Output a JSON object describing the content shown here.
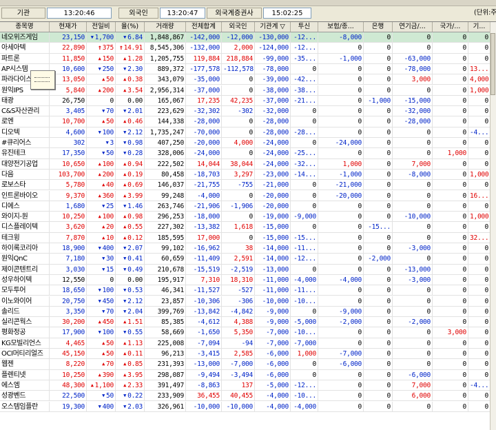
{
  "info_bar": {
    "inst_label": "기관",
    "inst_time": "13:20:46",
    "foreign_label": "외국인",
    "foreign_time": "13:20:47",
    "broker_label": "외국계증권사",
    "broker_time": "15:02:25",
    "unit_label": "(단위:주"
  },
  "headers": [
    "종목명",
    "현재가",
    "전일비",
    "율(%)",
    "거래량",
    "전체합계",
    "외국인",
    "기관계 ▽",
    "투신",
    "보험/종...",
    "은행",
    "연기금/...",
    "국가/...",
    "기..."
  ],
  "rows": [
    {
      "name": "네오위즈게임",
      "price": "23,150",
      "chg_dir": "dn",
      "chg": "1,700",
      "rate": "6.84",
      "vol": "1,848,867",
      "total": "-142,000",
      "foreign": "-12,000",
      "inst": "-130,000",
      "trust": "-12...",
      "ins": "-8,000",
      "bank": "0",
      "pension": "0",
      "nation": "0",
      "etc": "0"
    },
    {
      "name": "아세아텍",
      "price": "22,890",
      "chg_dir": "lim",
      "chg": "375",
      "rate": "14.91",
      "vol": "8,545,306",
      "total": "-132,000",
      "foreign": "2,000",
      "inst": "-124,000",
      "trust": "-12...",
      "ins": "0",
      "bank": "0",
      "pension": "0",
      "nation": "0",
      "etc": "0"
    },
    {
      "name": "파트론",
      "price": "11,850",
      "chg_dir": "up",
      "chg": "150",
      "rate": "1.28",
      "vol": "1,205,755",
      "total": "119,884",
      "foreign": "218,884",
      "inst": "-99,000",
      "trust": "-35...",
      "ins": "-1,000",
      "bank": "0",
      "pension": "-63,000",
      "nation": "0",
      "etc": "0"
    },
    {
      "name": "AP시스템",
      "price": "10,600",
      "chg_dir": "dn",
      "chg": "250",
      "rate": "2.30",
      "vol": "889,372",
      "total": "-177,578",
      "foreign": "-112,578",
      "inst": "-78,000",
      "trust": "0",
      "ins": "0",
      "bank": "0",
      "pension": "-78,000",
      "nation": "0",
      "etc": "13..."
    },
    {
      "name": "파라다이스",
      "price": "13,050",
      "chg_dir": "up",
      "chg": "50",
      "rate": "0.38",
      "vol": "343,079",
      "total": "-35,000",
      "foreign": "0",
      "inst": "-39,000",
      "trust": "-42...",
      "ins": "0",
      "bank": "0",
      "pension": "3,000",
      "nation": "0",
      "etc": "4,000"
    },
    {
      "name": "원익IPS",
      "price": "5,840",
      "chg_dir": "up",
      "chg": "200",
      "rate": "3.54",
      "vol": "2,956,314",
      "total": "-37,000",
      "foreign": "0",
      "inst": "-38,000",
      "trust": "-38...",
      "ins": "0",
      "bank": "0",
      "pension": "0",
      "nation": "0",
      "etc": "1,000"
    },
    {
      "name": "태광",
      "price": "26,750",
      "chg_dir": "none",
      "chg": "0",
      "rate": "0.00",
      "vol": "165,067",
      "total": "17,235",
      "foreign": "42,235",
      "inst": "-37,000",
      "trust": "-21...",
      "ins": "0",
      "bank": "-1,000",
      "pension": "-15,000",
      "nation": "0",
      "etc": "0"
    },
    {
      "name": "C&S자산관리",
      "price": "3,405",
      "chg_dir": "dn",
      "chg": "70",
      "rate": "2.01",
      "vol": "223,629",
      "total": "-32,302",
      "foreign": "-302",
      "inst": "-32,000",
      "trust": "0",
      "ins": "0",
      "bank": "0",
      "pension": "-32,000",
      "nation": "0",
      "etc": "0"
    },
    {
      "name": "로엔",
      "price": "10,700",
      "chg_dir": "up",
      "chg": "50",
      "rate": "0.46",
      "vol": "144,338",
      "total": "-28,000",
      "foreign": "0",
      "inst": "-28,000",
      "trust": "0",
      "ins": "0",
      "bank": "0",
      "pension": "-28,000",
      "nation": "0",
      "etc": "0"
    },
    {
      "name": "디오텍",
      "price": "4,600",
      "chg_dir": "dn",
      "chg": "100",
      "rate": "2.12",
      "vol": "1,735,247",
      "total": "-70,000",
      "foreign": "0",
      "inst": "-28,000",
      "trust": "-28...",
      "ins": "0",
      "bank": "0",
      "pension": "0",
      "nation": "0",
      "etc": "-4..."
    },
    {
      "name": "#큐리어스",
      "price": "302",
      "chg_dir": "dn",
      "chg": "3",
      "rate": "0.98",
      "vol": "407,250",
      "total": "-20,000",
      "foreign": "4,000",
      "inst": "-24,000",
      "trust": "0",
      "ins": "-24,000",
      "bank": "0",
      "pension": "0",
      "nation": "0",
      "etc": "0"
    },
    {
      "name": "유진테크",
      "price": "17,350",
      "chg_dir": "dn",
      "chg": "50",
      "rate": "0.28",
      "vol": "328,006",
      "total": "-24,000",
      "foreign": "0",
      "inst": "-24,000",
      "trust": "-25...",
      "ins": "0",
      "bank": "0",
      "pension": "0",
      "nation": "1,000",
      "etc": "0"
    },
    {
      "name": "대양전기공업",
      "price": "10,650",
      "chg_dir": "up",
      "chg": "100",
      "rate": "0.94",
      "vol": "222,502",
      "total": "14,044",
      "foreign": "38,044",
      "inst": "-24,000",
      "trust": "-32...",
      "ins": "1,000",
      "bank": "0",
      "pension": "7,000",
      "nation": "0",
      "etc": "0"
    },
    {
      "name": "다음",
      "price": "103,700",
      "chg_dir": "up",
      "chg": "200",
      "rate": "0.19",
      "vol": "80,458",
      "total": "-18,703",
      "foreign": "3,297",
      "inst": "-23,000",
      "trust": "-14...",
      "ins": "-1,000",
      "bank": "0",
      "pension": "-8,000",
      "nation": "0",
      "etc": "1,000"
    },
    {
      "name": "로보스타",
      "price": "5,780",
      "chg_dir": "up",
      "chg": "40",
      "rate": "0.69",
      "vol": "146,037",
      "total": "-21,755",
      "foreign": "-755",
      "inst": "-21,000",
      "trust": "0",
      "ins": "-21,000",
      "bank": "0",
      "pension": "0",
      "nation": "0",
      "etc": "0"
    },
    {
      "name": "인트론바이오",
      "price": "9,370",
      "chg_dir": "up",
      "chg": "360",
      "rate": "3.99",
      "vol": "99,248",
      "total": "-4,000",
      "foreign": "0",
      "inst": "-20,000",
      "trust": "0",
      "ins": "-20,000",
      "bank": "0",
      "pension": "0",
      "nation": "0",
      "etc": "16..."
    },
    {
      "name": "디에스",
      "price": "1,680",
      "chg_dir": "dn",
      "chg": "25",
      "rate": "1.46",
      "vol": "263,746",
      "total": "-21,906",
      "foreign": "-1,906",
      "inst": "-20,000",
      "trust": "0",
      "ins": "0",
      "bank": "0",
      "pension": "0",
      "nation": "0",
      "etc": "0"
    },
    {
      "name": "와이지-원",
      "price": "10,250",
      "chg_dir": "up",
      "chg": "100",
      "rate": "0.98",
      "vol": "296,253",
      "total": "-18,000",
      "foreign": "0",
      "inst": "-19,000",
      "trust": "-9,000",
      "ins": "0",
      "bank": "0",
      "pension": "-10,000",
      "nation": "0",
      "etc": "1,000"
    },
    {
      "name": "디스플레이텍",
      "price": "3,620",
      "chg_dir": "up",
      "chg": "20",
      "rate": "0.55",
      "vol": "227,302",
      "total": "-13,382",
      "foreign": "1,618",
      "inst": "-15,000",
      "trust": "0",
      "ins": "0",
      "bank": "-15...",
      "pension": "0",
      "nation": "0",
      "etc": "0"
    },
    {
      "name": "테크윙",
      "price": "7,870",
      "chg_dir": "up",
      "chg": "10",
      "rate": "0.12",
      "vol": "185,595",
      "total": "17,000",
      "foreign": "0",
      "inst": "-15,000",
      "trust": "-15...",
      "ins": "0",
      "bank": "0",
      "pension": "0",
      "nation": "0",
      "etc": "32..."
    },
    {
      "name": "하이록코리아",
      "price": "18,900",
      "chg_dir": "dn",
      "chg": "400",
      "rate": "2.07",
      "vol": "99,102",
      "total": "-16,962",
      "foreign": "38",
      "inst": "-14,000",
      "trust": "-11...",
      "ins": "0",
      "bank": "0",
      "pension": "-3,000",
      "nation": "0",
      "etc": "0"
    },
    {
      "name": "원익QnC",
      "price": "7,180",
      "chg_dir": "dn",
      "chg": "30",
      "rate": "0.41",
      "vol": "60,659",
      "total": "-11,409",
      "foreign": "2,591",
      "inst": "-14,000",
      "trust": "-12...",
      "ins": "0",
      "bank": "-2,000",
      "pension": "0",
      "nation": "0",
      "etc": "0"
    },
    {
      "name": "제이콘텐트리",
      "price": "3,030",
      "chg_dir": "dn",
      "chg": "15",
      "rate": "0.49",
      "vol": "210,678",
      "total": "-15,519",
      "foreign": "-2,519",
      "inst": "-13,000",
      "trust": "0",
      "ins": "0",
      "bank": "0",
      "pension": "-13,000",
      "nation": "0",
      "etc": "0"
    },
    {
      "name": "성우하이텍",
      "price": "12,550",
      "chg_dir": "none",
      "chg": "0",
      "rate": "0.00",
      "vol": "195,917",
      "total": "7,310",
      "foreign": "18,310",
      "inst": "-11,000",
      "trust": "-4,000",
      "ins": "-4,000",
      "bank": "0",
      "pension": "-3,000",
      "nation": "0",
      "etc": "0"
    },
    {
      "name": "모두투어",
      "price": "18,650",
      "chg_dir": "dn",
      "chg": "100",
      "rate": "0.53",
      "vol": "46,341",
      "total": "-11,527",
      "foreign": "-527",
      "inst": "-11,000",
      "trust": "-11...",
      "ins": "0",
      "bank": "0",
      "pension": "0",
      "nation": "0",
      "etc": "0"
    },
    {
      "name": "이노와이어",
      "price": "20,750",
      "chg_dir": "dn",
      "chg": "450",
      "rate": "2.12",
      "vol": "23,857",
      "total": "-10,306",
      "foreign": "-306",
      "inst": "-10,000",
      "trust": "-10...",
      "ins": "0",
      "bank": "0",
      "pension": "0",
      "nation": "0",
      "etc": "0"
    },
    {
      "name": "솔리드",
      "price": "3,350",
      "chg_dir": "dn",
      "chg": "70",
      "rate": "2.04",
      "vol": "399,769",
      "total": "-13,842",
      "foreign": "-4,842",
      "inst": "-9,000",
      "trust": "0",
      "ins": "-9,000",
      "bank": "0",
      "pension": "0",
      "nation": "0",
      "etc": "0"
    },
    {
      "name": "실리콘웍스",
      "price": "30,200",
      "chg_dir": "up",
      "chg": "450",
      "rate": "1.51",
      "vol": "85,385",
      "total": "-4,612",
      "foreign": "4,388",
      "inst": "-9,000",
      "trust": "-5,000",
      "ins": "-2,000",
      "bank": "0",
      "pension": "-2,000",
      "nation": "0",
      "etc": "0"
    },
    {
      "name": "평화정공",
      "price": "17,900",
      "chg_dir": "dn",
      "chg": "100",
      "rate": "0.55",
      "vol": "58,669",
      "total": "-1,650",
      "foreign": "5,350",
      "inst": "-7,000",
      "trust": "-10...",
      "ins": "0",
      "bank": "0",
      "pension": "0",
      "nation": "3,000",
      "etc": "0"
    },
    {
      "name": "KG모빌리언스",
      "price": "4,465",
      "chg_dir": "up",
      "chg": "50",
      "rate": "1.13",
      "vol": "225,008",
      "total": "-7,094",
      "foreign": "-94",
      "inst": "-7,000",
      "trust": "-7,000",
      "ins": "0",
      "bank": "0",
      "pension": "0",
      "nation": "0",
      "etc": "0"
    },
    {
      "name": "OCI머티리얼즈",
      "price": "45,150",
      "chg_dir": "up",
      "chg": "50",
      "rate": "0.11",
      "vol": "96,213",
      "total": "-3,415",
      "foreign": "2,585",
      "inst": "-6,000",
      "trust": "1,000",
      "ins": "-7,000",
      "bank": "0",
      "pension": "0",
      "nation": "0",
      "etc": "0"
    },
    {
      "name": "웹젠",
      "price": "8,220",
      "chg_dir": "up",
      "chg": "70",
      "rate": "0.85",
      "vol": "231,393",
      "total": "-13,000",
      "foreign": "-7,000",
      "inst": "-6,000",
      "trust": "0",
      "ins": "-6,000",
      "bank": "0",
      "pension": "0",
      "nation": "0",
      "etc": "0"
    },
    {
      "name": "플렌티넷",
      "price": "10,250",
      "chg_dir": "up",
      "chg": "390",
      "rate": "3.95",
      "vol": "298,087",
      "total": "-9,494",
      "foreign": "-3,494",
      "inst": "-6,000",
      "trust": "0",
      "ins": "0",
      "bank": "0",
      "pension": "-6,000",
      "nation": "0",
      "etc": "0"
    },
    {
      "name": "에스엠",
      "price": "48,300",
      "chg_dir": "up",
      "chg": "1,100",
      "rate": "2.33",
      "vol": "391,497",
      "total": "-8,863",
      "foreign": "137",
      "inst": "-5,000",
      "trust": "-12...",
      "ins": "0",
      "bank": "0",
      "pension": "7,000",
      "nation": "0",
      "etc": "-4..."
    },
    {
      "name": "성광벤드",
      "price": "22,500",
      "chg_dir": "dn",
      "chg": "50",
      "rate": "0.22",
      "vol": "233,909",
      "total": "36,455",
      "foreign": "40,455",
      "inst": "-4,000",
      "trust": "-10...",
      "ins": "0",
      "bank": "0",
      "pension": "6,000",
      "nation": "0",
      "etc": "0"
    },
    {
      "name": "오스템임플란",
      "price": "19,300",
      "chg_dir": "dn",
      "chg": "400",
      "rate": "2.03",
      "vol": "326,961",
      "total": "-10,000",
      "foreign": "-10,000",
      "inst": "-4,000",
      "trust": "-4,000",
      "ins": "0",
      "bank": "0",
      "pension": "0",
      "nation": "0",
      "etc": "0"
    }
  ]
}
